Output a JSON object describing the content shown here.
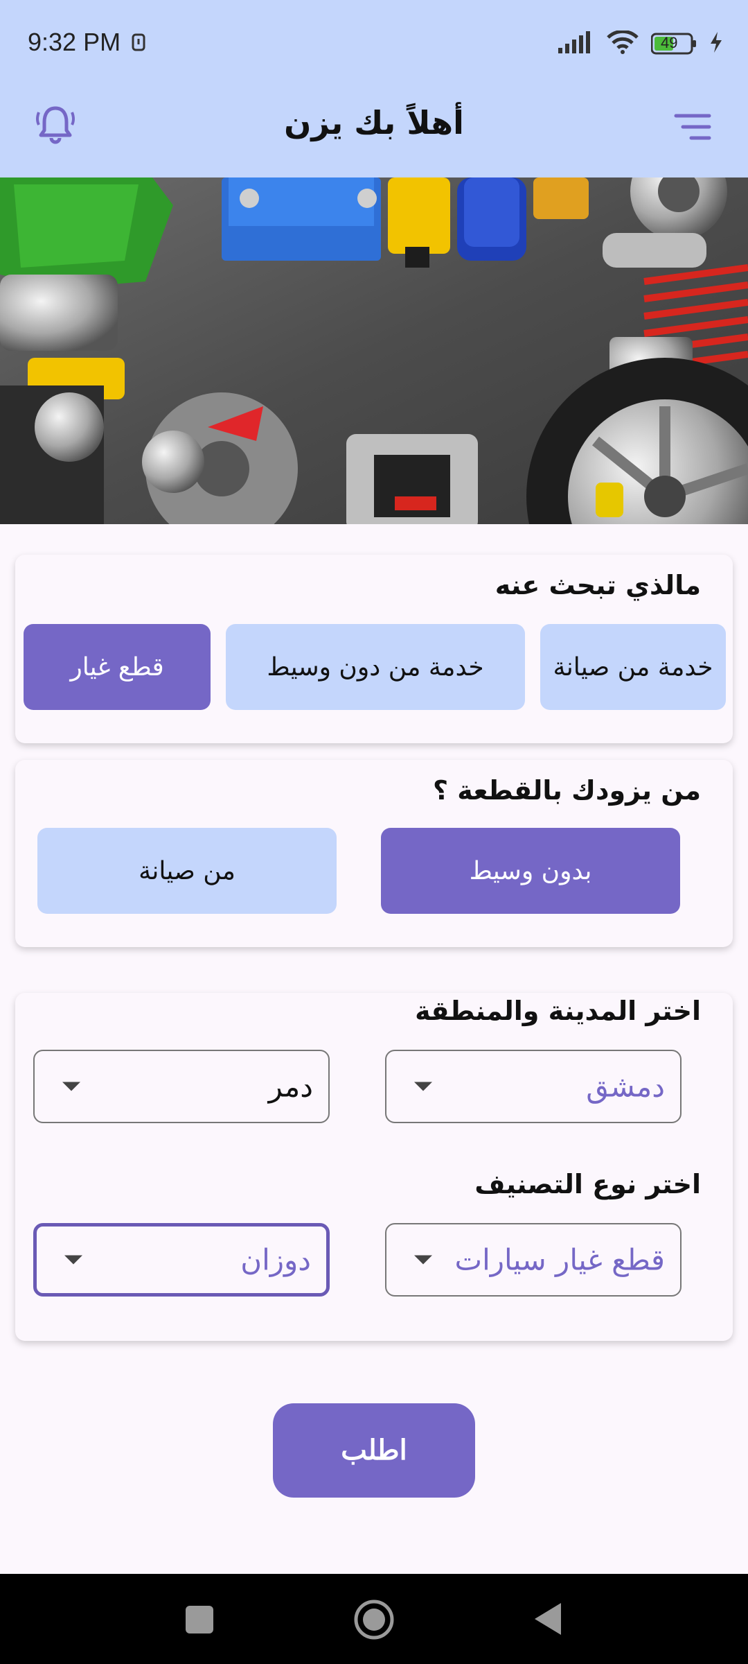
{
  "status_bar": {
    "time": "9:32 PM",
    "battery": "49"
  },
  "header": {
    "title": "أهلاً بك يزن",
    "icons": {
      "left": "bell-icon",
      "right": "menu-icon"
    }
  },
  "hero": {
    "image": "car-parts-photo"
  },
  "search_type": {
    "title": "مالذي تبحث عنه",
    "options": [
      {
        "label": "خدمة من صيانة",
        "selected": false
      },
      {
        "label": "خدمة من دون وسيط",
        "selected": false
      },
      {
        "label": "قطع غيار",
        "selected": true
      }
    ]
  },
  "supplier": {
    "title": "من يزودك بالقطعة ؟",
    "options": [
      {
        "label": "بدون وسيط",
        "selected": true
      },
      {
        "label": "من صيانة",
        "selected": false
      }
    ]
  },
  "location": {
    "title": "اختر المدينة والمنطقة",
    "city": "دمشق",
    "area": "دمر"
  },
  "category": {
    "title": "اختر نوع التصنيف",
    "type": "قطع غيار سيارات",
    "sub": "دوزان"
  },
  "submit_label": "اطلب",
  "colors": {
    "primary": "#7567c6",
    "light": "#c4d6fc",
    "background": "#fcf7fd"
  }
}
